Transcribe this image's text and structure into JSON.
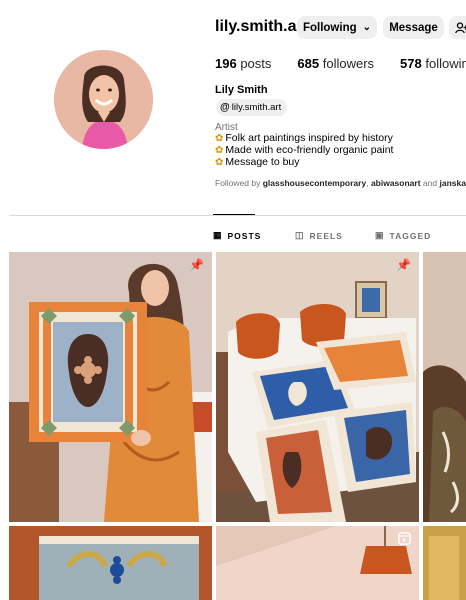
{
  "profile": {
    "username": "lily.smith.art",
    "full_name": "Lily Smith",
    "threads_handle": "lily.smith.art",
    "category": "Artist",
    "bio_lines": [
      "Folk art paintings inspired by history",
      "Made with eco-friendly organic paint",
      "Message to buy"
    ],
    "followed_by_prefix": "Followed by",
    "followed_by_1": "glasshousecontemporary",
    "followed_by_sep": ",",
    "followed_by_2": "abiwasonart",
    "followed_by_and": "and",
    "followed_by_3": "janskacel"
  },
  "stats": {
    "posts_count": "196",
    "posts_label": "posts",
    "followers_count": "685",
    "followers_label": "followers",
    "following_count": "578",
    "following_label": "following"
  },
  "actions": {
    "following_label": "Following",
    "message_label": "Message"
  },
  "tabs": {
    "posts": "POSTS",
    "reels": "REELS",
    "tagged": "TAGGED",
    "active": "posts"
  },
  "posts": [
    {
      "type": "pinned",
      "icon": "pin-icon"
    },
    {
      "type": "pinned",
      "icon": "pin-icon"
    },
    {
      "type": "image"
    },
    {
      "type": "image"
    },
    {
      "type": "reel",
      "icon": "reel-icon"
    },
    {
      "type": "image"
    }
  ],
  "colors": {
    "button_bg": "#efefef",
    "muted_text": "#737373",
    "divider": "#dbdbdb",
    "flower": "#d99400"
  }
}
